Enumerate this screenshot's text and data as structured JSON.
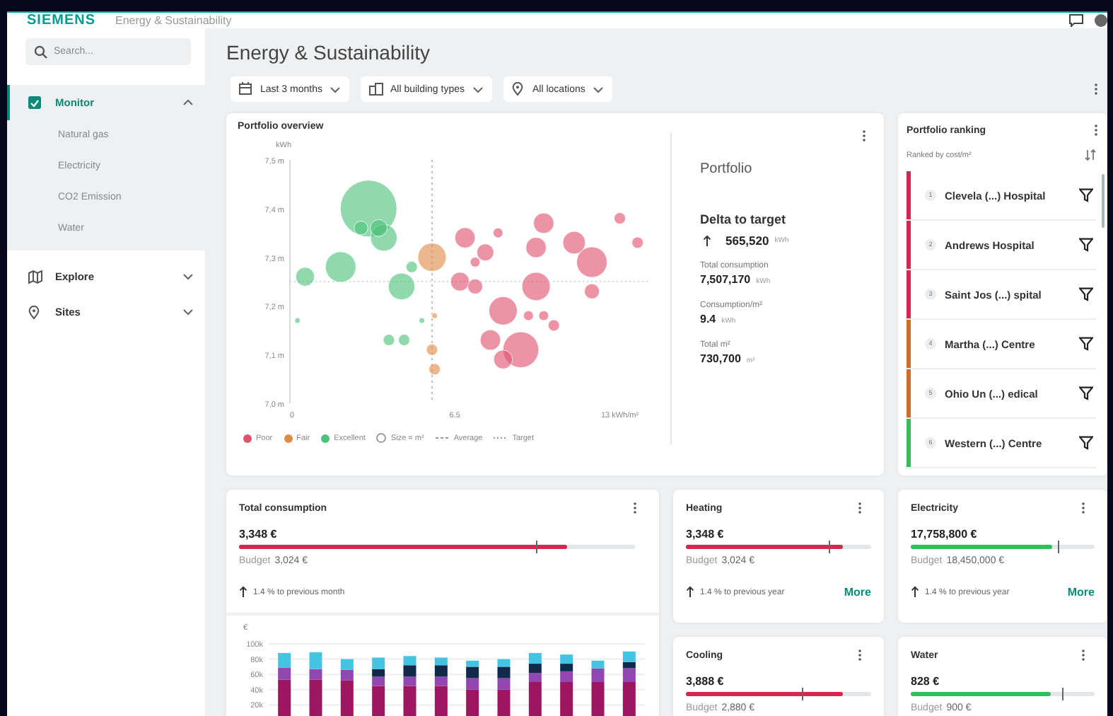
{
  "topbar": {
    "brand": "SIEMENS",
    "app_name": "Energy & Sustainability"
  },
  "sidebar": {
    "search": {
      "placeholder": "Search..."
    },
    "items": [
      {
        "label": "Monitor",
        "selected": true,
        "expanded": true,
        "children": [
          {
            "label": "Natural gas",
            "selected": false
          },
          {
            "label": "Electricity",
            "selected": false
          },
          {
            "label": "CO2 Emission",
            "selected": false
          },
          {
            "label": "Water",
            "selected": false
          }
        ]
      },
      {
        "label": "Explore",
        "selected": false,
        "expanded": false
      },
      {
        "label": "Sites",
        "selected": false,
        "expanded": false
      }
    ]
  },
  "page_title": "Energy & Sustainability",
  "filters": [
    {
      "label": "Last 3 months"
    },
    {
      "label": "All building types"
    },
    {
      "label": "All locations"
    }
  ],
  "portfolio_overview": {
    "title": "Portfolio overview",
    "chart_data": {
      "type": "scatter",
      "ylabel": "kWh",
      "xlim": [
        0,
        14.1
      ],
      "ylim": [
        7.0,
        7.5
      ],
      "xticks": [
        {
          "value": 0,
          "label": "0"
        },
        {
          "value": 6.5,
          "label": "6.5"
        },
        {
          "value": 13,
          "label": "13 kWh/m²"
        }
      ],
      "yticks": [
        {
          "value": 7.0,
          "label": "7,0 m"
        },
        {
          "value": 7.1,
          "label": "7,1 m"
        },
        {
          "value": 7.2,
          "label": "7,2 m"
        },
        {
          "value": 7.3,
          "label": "7,3 m"
        },
        {
          "value": 7.4,
          "label": "7,4 m"
        },
        {
          "value": 7.5,
          "label": "7,5 m"
        }
      ],
      "series": [
        {
          "name": "Poor",
          "color": "#e0536f",
          "x": [
            6.9,
            8.2,
            7.7,
            7.3,
            6.7,
            7.3,
            10.0,
            9.7,
            11.2,
            11.9,
            9.7,
            11.9,
            13.0,
            13.7,
            8.4,
            9.4,
            10.0,
            10.4,
            7.9,
            9.1,
            8.4
          ],
          "values": [
            7.34,
            7.35,
            7.31,
            7.29,
            7.25,
            7.24,
            7.37,
            7.32,
            7.33,
            7.29,
            7.24,
            7.23,
            7.38,
            7.33,
            7.19,
            7.18,
            7.18,
            7.16,
            7.13,
            7.11,
            7.09
          ],
          "sizes": [
            0.13,
            0.03,
            0.09,
            0.03,
            0.11,
            0.07,
            0.13,
            0.13,
            0.16,
            0.29,
            0.25,
            0.07,
            0.04,
            0.04,
            0.25,
            0.03,
            0.03,
            0.04,
            0.13,
            0.4,
            0.11
          ]
        },
        {
          "name": "Fair",
          "color": "#e08a45",
          "x": [
            5.6,
            5.7,
            5.6,
            5.7
          ],
          "values": [
            7.3,
            7.18,
            7.11,
            7.07
          ],
          "sizes": [
            0.25,
            0.01,
            0.04,
            0.04
          ]
        },
        {
          "name": "Excellent",
          "color": "#4cc27a",
          "x": [
            3.1,
            2.8,
            3.5,
            3.7,
            0.6,
            2.0,
            4.4,
            4.8,
            0.3,
            3.9,
            4.5,
            5.2
          ],
          "values": [
            7.4,
            7.36,
            7.36,
            7.34,
            7.26,
            7.28,
            7.24,
            7.28,
            7.17,
            7.13,
            7.13,
            7.17
          ],
          "sizes": [
            1.0,
            0.06,
            0.09,
            0.22,
            0.11,
            0.29,
            0.22,
            0.04,
            0.01,
            0.04,
            0.04,
            0.01
          ]
        }
      ],
      "ref_lines": [
        {
          "axis": "x",
          "value": 5.6,
          "label": "Average"
        },
        {
          "axis": "y",
          "value": 7.25,
          "label": "Target"
        }
      ]
    },
    "size_legend": "Size = m²",
    "summary": {
      "title": "Portfolio",
      "delta": {
        "label": "Delta to target",
        "value": "565,520",
        "unit": "kWh"
      },
      "stats": [
        {
          "label": "Total consumption",
          "value": "7,507,170",
          "unit": "kWh"
        },
        {
          "label": "Consumption/m²",
          "value": "9.4",
          "unit": "kWh"
        },
        {
          "label": "Total m²",
          "value": "730,700",
          "unit": "m²"
        }
      ]
    }
  },
  "ranking": {
    "title": "Portfolio ranking",
    "subtitle": "Ranked by cost/m²",
    "items": [
      {
        "rank": "1",
        "name": "Clevela (...) Hospital",
        "color": "#d7264f"
      },
      {
        "rank": "2",
        "name": "Andrews Hospital",
        "color": "#d7264f"
      },
      {
        "rank": "3",
        "name": "Saint Jos (...) spital",
        "color": "#d7264f"
      },
      {
        "rank": "4",
        "name": "Martha (...) Centre",
        "color": "#d8691e"
      },
      {
        "rank": "5",
        "name": "Ohio Un (...) edical",
        "color": "#d8691e"
      },
      {
        "rank": "6",
        "name": "Western (...) Centre",
        "color": "#2fbf5b"
      }
    ]
  },
  "total_consumption": {
    "title": "Total consumption",
    "value": "3,348 €",
    "level": 0.83,
    "color": "#d7264f",
    "budget_label": "Budget",
    "budget": "3,024 €",
    "trend": "1.4 % to previous month",
    "chart_data": {
      "type": "bar",
      "stacked": true,
      "grid": true,
      "ylabel": "€",
      "ylim": [
        0,
        100
      ],
      "yticks": [
        {
          "value": 20,
          "label": "20k"
        },
        {
          "value": 40,
          "label": "40k"
        },
        {
          "value": 60,
          "label": "60k"
        },
        {
          "value": 80,
          "label": "80k"
        },
        {
          "value": 100,
          "label": "100k"
        }
      ],
      "series": [
        {
          "color": "#9c1660",
          "values": [
            53,
            53,
            52,
            45,
            45,
            45,
            40,
            40,
            50,
            50,
            50,
            50
          ]
        },
        {
          "color": "#9146b0",
          "values": [
            16,
            14,
            14,
            12,
            12,
            12,
            15,
            15,
            12,
            14,
            18,
            18
          ]
        },
        {
          "color": "#11294a",
          "values": [
            0,
            0,
            0,
            10,
            15,
            15,
            15,
            15,
            12,
            10,
            0,
            8
          ]
        },
        {
          "color": "#44c4e2",
          "values": [
            19,
            22,
            14,
            15,
            12,
            10,
            8,
            10,
            14,
            12,
            10,
            14
          ]
        }
      ]
    }
  },
  "tiles": [
    {
      "title": "Heating",
      "value": "3,348 €",
      "level": 0.85,
      "color": "#d7264f",
      "budget_label": "Budget",
      "budget": "3,024 €",
      "trend": "1.4 % to previous year",
      "more": "More"
    },
    {
      "title": "Electricity",
      "value": "17,758,800 €",
      "level": 0.77,
      "color": "#2fbf5b",
      "budget_label": "Budget",
      "budget": "18,450,000 €",
      "trend": "1.4 % to previous year",
      "more": "More"
    },
    {
      "title": "Cooling",
      "value": "3,888 €",
      "level": 0.85,
      "color": "#d7264f",
      "budget_label": "Budget",
      "budget": "2,880 €"
    },
    {
      "title": "Water",
      "value": "828 €",
      "level": 0.76,
      "color": "#2fbf5b",
      "budget_label": "Budget",
      "budget": "900 €"
    }
  ]
}
